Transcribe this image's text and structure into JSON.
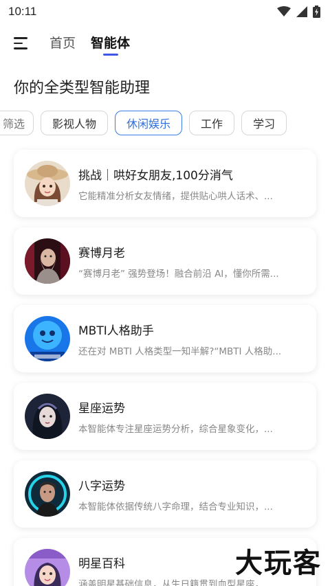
{
  "status_bar": {
    "time": "10:11",
    "wifi_icon": "wifi-icon",
    "signal_icon": "signal-icon",
    "battery_icon": "battery-charging-icon"
  },
  "nav": {
    "menu_icon": "menu-icon",
    "tabs": [
      {
        "label": "首页",
        "active": false
      },
      {
        "label": "智能体",
        "active": true
      }
    ],
    "accent_color": "#3d57e6"
  },
  "headline": "你的全类型智能助理",
  "filters": [
    {
      "label": "筛选",
      "state": "partial"
    },
    {
      "label": "影视人物",
      "state": "normal"
    },
    {
      "label": "休闲娱乐",
      "state": "active"
    },
    {
      "label": "工作",
      "state": "normal"
    },
    {
      "label": "学习",
      "state": "normal"
    }
  ],
  "filter_active_color": "#2f6fe0",
  "agents": [
    {
      "title": "挑战｜哄好女朋友,100分消气",
      "desc": "它能精准分析女友情绪，提供贴心哄人话术、..."
    },
    {
      "title": "赛博月老",
      "desc": "“赛博月老” 强势登场！融合前沿 AI，懂你所需..."
    },
    {
      "title": "MBTI人格助手",
      "desc": "还在对 MBTI 人格类型一知半解?“MBTI 人格助..."
    },
    {
      "title": "星座运势",
      "desc": "本智能体专注星座运势分析，综合星象变化，..."
    },
    {
      "title": "八字运势",
      "desc": "本智能体依据传统八字命理，结合专业知识，..."
    },
    {
      "title": "明星百科",
      "desc": "涵盖明星基础信息，从生日籍贯到血型星座，..."
    }
  ],
  "watermark": "大玩客"
}
